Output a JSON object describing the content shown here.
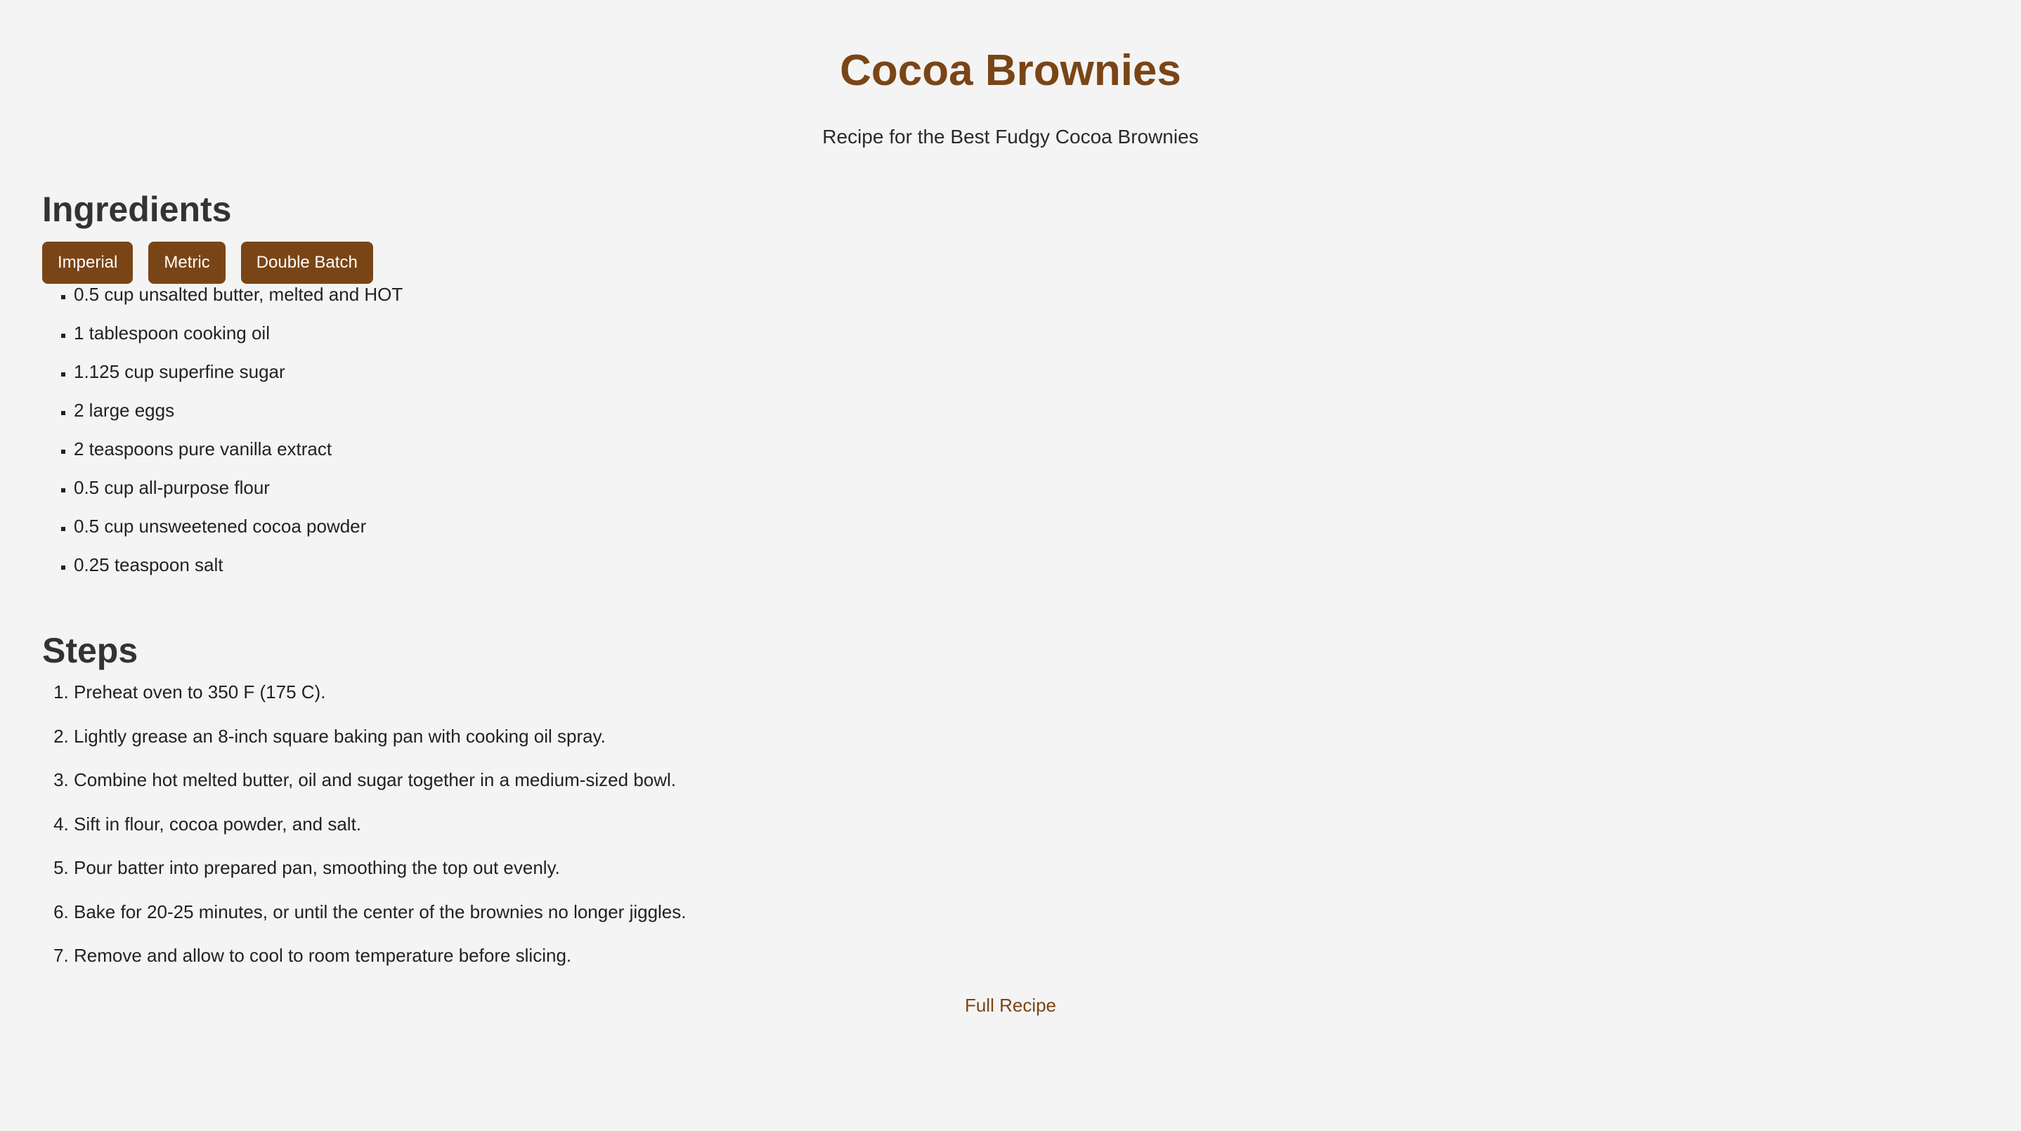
{
  "header": {
    "title": "Cocoa Brownies",
    "subtitle": "Recipe for the Best Fudgy Cocoa Brownies"
  },
  "ingredients": {
    "heading": "Ingredients",
    "buttons": [
      "Imperial",
      "Metric",
      "Double Batch"
    ],
    "items": [
      "0.5 cup unsalted butter, melted and HOT",
      "1 tablespoon cooking oil",
      "1.125 cup superfine sugar",
      "2 large eggs",
      "2 teaspoons pure vanilla extract",
      "0.5 cup all-purpose flour",
      "0.5 cup unsweetened cocoa powder",
      "0.25 teaspoon salt"
    ]
  },
  "steps": {
    "heading": "Steps",
    "items": [
      "Preheat oven to 350 F (175 C).",
      "Lightly grease an 8-inch square baking pan with cooking oil spray.",
      "Combine hot melted butter, oil and sugar together in a medium-sized bowl.",
      "Sift in flour, cocoa powder, and salt.",
      "Pour batter into prepared pan, smoothing the top out evenly.",
      "Bake for 20-25 minutes, or until the center of the brownies no longer jiggles.",
      "Remove and allow to cool to room temperature before slicing."
    ]
  },
  "footer": {
    "link_label": "Full Recipe"
  },
  "colors": {
    "accent": "#7a4516",
    "background": "#f4f4f4",
    "text": "#222222"
  }
}
